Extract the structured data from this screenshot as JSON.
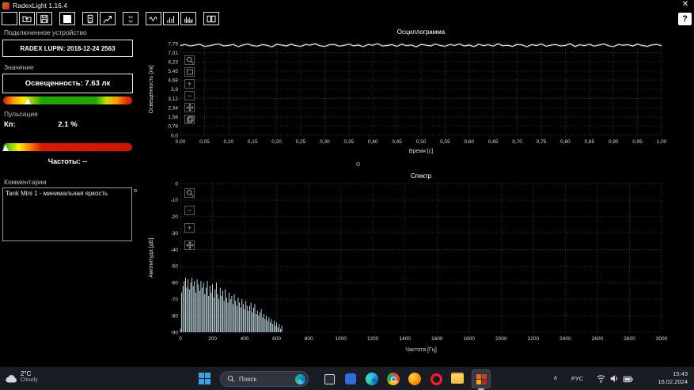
{
  "window": {
    "title": "RadexLight 1.16.4",
    "help_label": "?",
    "close_label": "✕"
  },
  "toolbar": {
    "icons": [
      "open-folder-icon",
      "import-folder-icon",
      "save-icon",
      "white-square-icon",
      "device-icon",
      "export-graph-icon",
      "timer-12-34-icon",
      "oscillogram-view-icon",
      "histogram-view-icon",
      "spectrum-view-icon",
      "split-view-icon"
    ]
  },
  "sidebar": {
    "device_section": "Подключенное устройство",
    "device_name": "RADEX LUPIN: 2018-12-24 2563",
    "value_section": "Значение",
    "illuminance": "Освещенность: 7.63 лк",
    "pulsation_section": "Пульсация",
    "kp_label": "Кп:",
    "kp_value": "2.1 %",
    "frequencies": "Частоты: --",
    "comments_section": "Комментарии",
    "comment_text": "Tank Mini 1 - минимальная яркость",
    "illuminance_scale": {
      "marker_pos": 0.19,
      "gradient": [
        "#cf2200 0%",
        "#ff9900 8%",
        "#ffee00 16%",
        "#1fa800 30%",
        "#1fa800 72%",
        "#c8e000 80%",
        "#ff9900 88%",
        "#e03000 96%",
        "#cf2200 100%"
      ]
    },
    "kp_scale": {
      "marker_pos": 0.02,
      "gradient": [
        "#1fa800 0%",
        "#8fd400 6%",
        "#ffee00 12%",
        "#ff8800 20%",
        "#e01800 30%",
        "#cf1400 100%"
      ]
    }
  },
  "chart_data": [
    {
      "type": "line",
      "title": "Осциллограмма",
      "xlabel": "Время [с]",
      "ylabel": "Освещенность [лк]",
      "xlim": [
        0,
        1
      ],
      "ylim": [
        0,
        7.79
      ],
      "grid": true,
      "legend": false,
      "x_tick_values": [
        0,
        0.05,
        0.1,
        0.15,
        0.2,
        0.25,
        0.3,
        0.35,
        0.4,
        0.45,
        0.5,
        0.55,
        0.6,
        0.65,
        0.7,
        0.75,
        0.8,
        0.85,
        0.9,
        0.95,
        1.0
      ],
      "x_tick_labels": [
        "0,00",
        "0,05",
        "0,10",
        "0,15",
        "0,20",
        "0,25",
        "0,30",
        "0,35",
        "0,40",
        "0,45",
        "0,50",
        "0,55",
        "0,60",
        "0,65",
        "0,70",
        "0,75",
        "0,80",
        "0,85",
        "0,90",
        "0,95",
        "1,00"
      ],
      "y_tick_values": [
        0,
        0.78,
        1.56,
        2.34,
        3.12,
        3.9,
        4.68,
        5.45,
        6.23,
        7.01,
        7.79
      ],
      "y_tick_labels": [
        "0,0",
        "0,78",
        "1,56",
        "2,34",
        "3,12",
        "3,9",
        "4,68",
        "5,45",
        "6,23",
        "7,01",
        "7,79"
      ],
      "series": [
        {
          "name": "Освещенность",
          "color": "#eef8fb",
          "y": [
            7.62,
            7.7,
            7.58,
            7.65,
            7.72,
            7.55,
            7.6,
            7.68,
            7.74,
            7.59,
            7.63,
            7.71,
            7.52,
            7.66,
            7.75,
            7.61,
            7.57,
            7.69,
            7.64,
            7.5,
            7.72,
            7.66,
            7.58,
            7.73,
            7.61,
            7.55,
            7.7,
            7.65,
            7.76,
            7.6,
            7.54,
            7.68,
            7.71,
            7.57,
            7.63,
            7.74,
            7.59,
            7.66,
            7.52,
            7.7,
            7.64,
            7.77,
            7.58,
            7.62,
            7.69,
            7.55,
            7.73,
            7.6,
            7.67,
            7.51,
            7.71,
            7.65,
            7.59,
            7.74,
            7.62,
            7.56,
            7.7,
            7.63,
            7.75,
            7.58,
            7.66,
            7.53,
            7.72,
            7.61,
            7.68,
            7.57,
            7.76,
            7.6,
            7.64,
            7.55,
            7.71,
            7.67,
            7.52,
            7.69,
            7.62,
            7.74,
            7.56,
            7.65,
            7.7,
            7.59,
            7.63,
            7.77,
            7.54,
            7.68,
            7.61,
            7.72,
            7.57,
            7.66,
            7.75,
            7.6,
            7.53,
            7.7,
            7.64,
            7.69,
            7.58,
            7.73,
            7.62,
            7.55,
            7.67,
            7.71,
            7.61
          ]
        }
      ]
    },
    {
      "type": "bar",
      "title": "Спектр",
      "xlabel": "Частота [Гц]",
      "ylabel": "Амплитуда [дБ]",
      "xlim": [
        0,
        3000
      ],
      "ylim": [
        -90,
        0
      ],
      "grid": true,
      "legend": false,
      "color": "#cfe9f2",
      "x_tick_values": [
        0,
        200,
        400,
        600,
        800,
        1000,
        1200,
        1400,
        1600,
        1800,
        2000,
        2200,
        2400,
        2600,
        2800,
        3000
      ],
      "x_tick_labels": [
        "0",
        "200",
        "400",
        "600",
        "800",
        "1000",
        "1200",
        "1400",
        "1600",
        "1800",
        "2000",
        "2200",
        "2400",
        "2600",
        "2800",
        "3000"
      ],
      "y_tick_values": [
        0,
        -10,
        -20,
        -30,
        -40,
        -50,
        -60,
        -70,
        -80,
        -90
      ],
      "y_tick_labels": [
        "0",
        "-10",
        "-20",
        "-30",
        "-40",
        "-50",
        "-60",
        "-70",
        "-80",
        "-90"
      ],
      "freq_start": 0,
      "freq_step": 8,
      "values_db": [
        -88,
        -66,
        -62,
        -59,
        -57,
        -63,
        -58,
        -64,
        -60,
        -57,
        -62,
        -59,
        -66,
        -58,
        -61,
        -65,
        -59,
        -63,
        -60,
        -67,
        -63,
        -59,
        -68,
        -62,
        -66,
        -61,
        -69,
        -64,
        -60,
        -67,
        -70,
        -63,
        -68,
        -65,
        -71,
        -64,
        -69,
        -72,
        -66,
        -70,
        -68,
        -73,
        -67,
        -71,
        -74,
        -69,
        -72,
        -75,
        -70,
        -73,
        -76,
        -71,
        -74,
        -77,
        -74,
        -72,
        -78,
        -75,
        -73,
        -79,
        -77,
        -80,
        -78,
        -76,
        -81,
        -79,
        -82,
        -80,
        -83,
        -81,
        -84,
        -82,
        -85,
        -83,
        -86,
        -84,
        -87,
        -85,
        -88,
        -86
      ]
    }
  ],
  "taskbar": {
    "weather_temp": "2°C",
    "weather_cond": "Cloudy",
    "search_placeholder": "Поиск",
    "language": "РУС",
    "time": "15:43",
    "date": "16.02.2024",
    "apps": [
      "task-view",
      "documents",
      "edge",
      "chrome",
      "firefox",
      "opera",
      "file-explorer",
      "radexlight-active"
    ]
  }
}
